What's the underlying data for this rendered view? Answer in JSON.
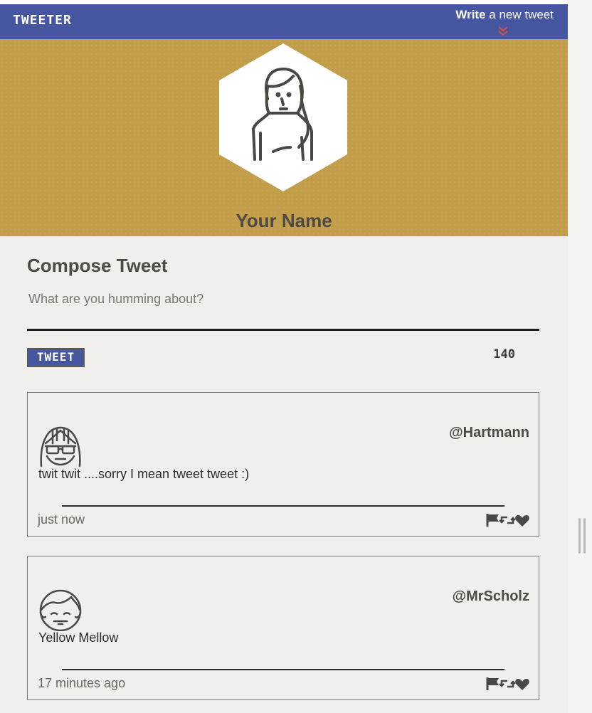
{
  "nav": {
    "brand": "TWEETER",
    "write_bold": "Write",
    "write_rest": " a new tweet"
  },
  "profile": {
    "name": "Your Name"
  },
  "compose": {
    "title": "Compose Tweet",
    "placeholder": "What are you humming about?",
    "button_label": "TWEET",
    "counter": "140"
  },
  "tweets": [
    {
      "handle": "@Hartmann",
      "content": "twit twit ....sorry I mean tweet tweet :)",
      "time": "just now",
      "avatar": "girl-glasses-avatar"
    },
    {
      "handle": "@MrScholz",
      "content": "Yellow Mellow",
      "time": "17 minutes ago",
      "avatar": "boy-avatar"
    }
  ],
  "icons": {
    "flag": "flag-icon",
    "retweet": "retweet-icon",
    "like": "heart-icon",
    "write": "double-chevron-down-icon"
  },
  "colors": {
    "nav": "#4656a0",
    "header": "#c39e4a",
    "accent": "#e0503a",
    "background": "#f0efeb"
  }
}
